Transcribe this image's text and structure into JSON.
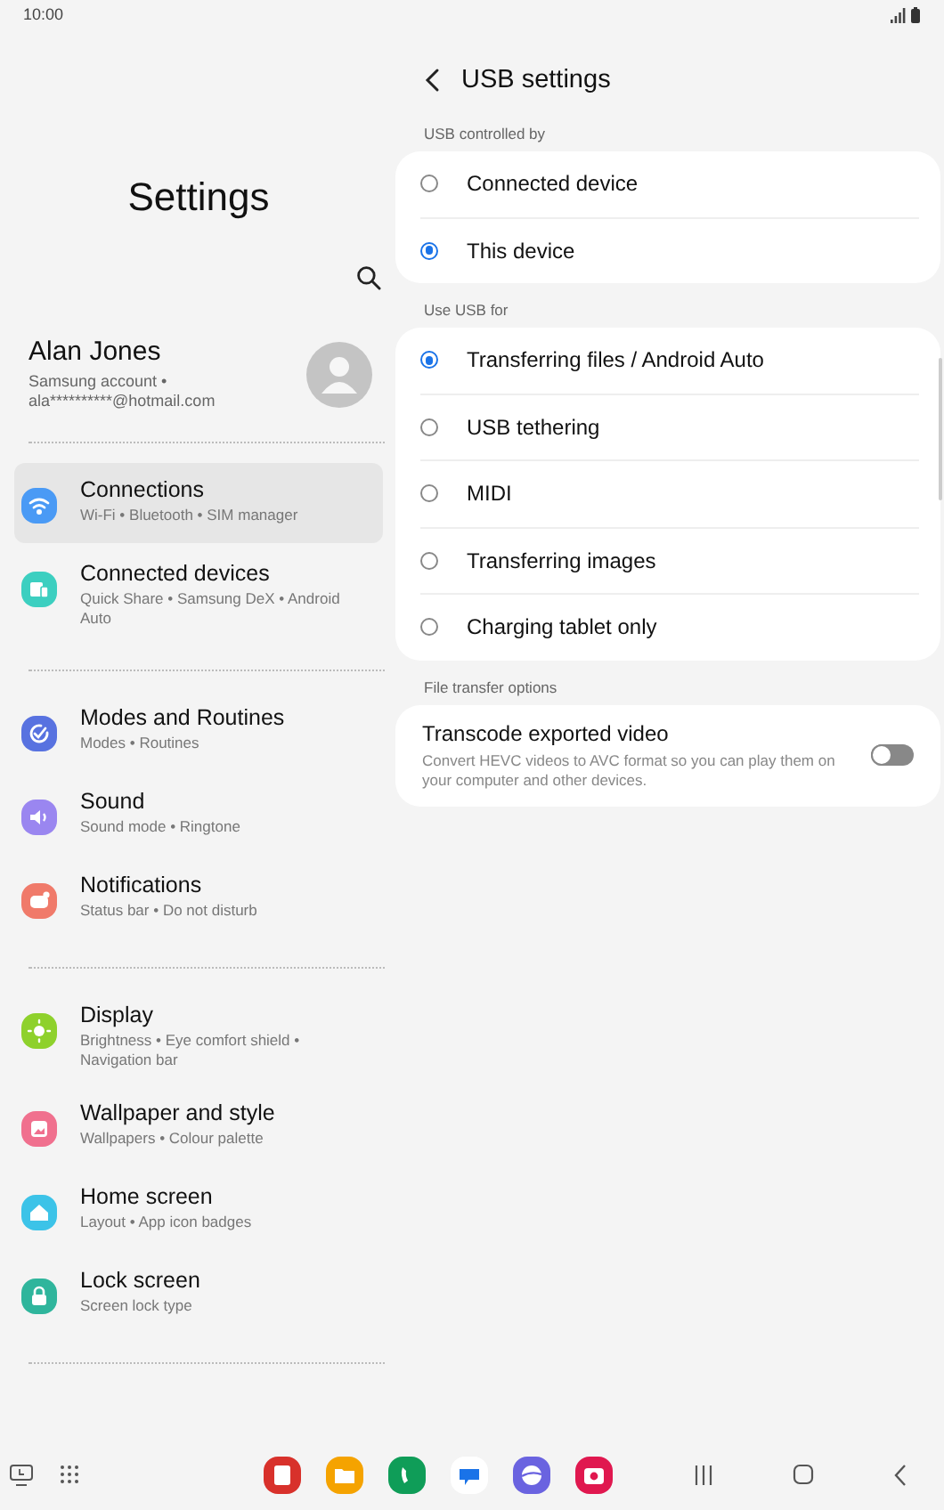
{
  "status_bar": {
    "time": "10:00"
  },
  "sidebar": {
    "title": "Settings",
    "profile": {
      "name": "Alan Jones",
      "detail": "Samsung account  •  ala**********@hotmail.com"
    },
    "groups": [
      [
        {
          "label": "Connections",
          "sub": "Wi-Fi  •  Bluetooth  •  SIM manager",
          "selected": true,
          "color": "#4a9af5"
        },
        {
          "label": "Connected devices",
          "sub": "Quick Share  •  Samsung DeX  •  Android Auto",
          "selected": false,
          "color": "#3ccfc0"
        }
      ],
      [
        {
          "label": "Modes and Routines",
          "sub": "Modes  •  Routines",
          "selected": false,
          "color": "#5872e0"
        },
        {
          "label": "Sound",
          "sub": "Sound mode  •  Ringtone",
          "selected": false,
          "color": "#9a86f0"
        },
        {
          "label": "Notifications",
          "sub": "Status bar  •  Do not disturb",
          "selected": false,
          "color": "#f07a6a"
        }
      ],
      [
        {
          "label": "Display",
          "sub": "Brightness  •  Eye comfort shield  •  Navigation bar",
          "selected": false,
          "color": "#8ed12c"
        },
        {
          "label": "Wallpaper and style",
          "sub": "Wallpapers  •  Colour palette",
          "selected": false,
          "color": "#f0708e"
        },
        {
          "label": "Home screen",
          "sub": "Layout  •  App icon badges",
          "selected": false,
          "color": "#3cc3e8"
        },
        {
          "label": "Lock screen",
          "sub": "Screen lock type",
          "selected": false,
          "color": "#2fb59c"
        }
      ]
    ]
  },
  "panel": {
    "title": "USB settings",
    "sections": [
      {
        "heading": "USB controlled by",
        "options": [
          {
            "label": "Connected device",
            "selected": false
          },
          {
            "label": "This device",
            "selected": true
          }
        ]
      },
      {
        "heading": "Use USB for",
        "options": [
          {
            "label": "Transferring files / Android Auto",
            "selected": true
          },
          {
            "label": "USB tethering",
            "selected": false
          },
          {
            "label": "MIDI",
            "selected": false
          },
          {
            "label": "Transferring images",
            "selected": false
          },
          {
            "label": "Charging tablet only",
            "selected": false
          }
        ]
      }
    ],
    "file_transfer": {
      "heading": "File transfer options",
      "title": "Transcode exported video",
      "description": "Convert HEVC videos to AVC format so you can play them on your computer and other devices.",
      "on": false
    }
  },
  "taskbar": {
    "apps": [
      {
        "color": "#d8312b"
      },
      {
        "color": "#f5a300"
      },
      {
        "color": "#0f9d58"
      },
      {
        "color": "#ffffff"
      },
      {
        "color": "#6a63e0"
      },
      {
        "color": "#e0184f"
      }
    ]
  }
}
